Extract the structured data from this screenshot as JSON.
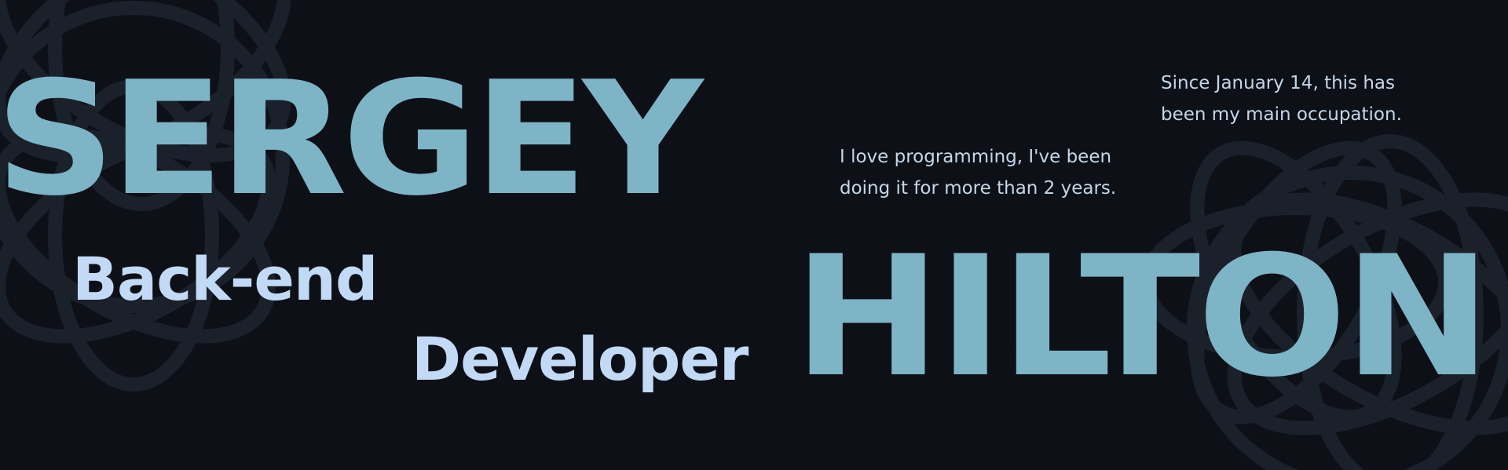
{
  "colors": {
    "background": "#0e1017",
    "name_text": "#7db4c6",
    "role_text": "#c2daf5",
    "body_text": "#c6d6e8",
    "pattern_stroke": "#1b212b"
  },
  "hero": {
    "first_name": "SERGEY",
    "last_name": "HILTON",
    "role_line_1": "Back-end",
    "role_line_2": "Developer"
  },
  "blurbs": {
    "programming": {
      "line_1": "I love programming, I've been",
      "line_2": "doing it for more than 2 years."
    },
    "occupation": {
      "line_1": "Since January 14, this has",
      "line_2": "been my main occupation."
    }
  },
  "decoration": {
    "pattern_icon": "flower-of-life-pattern"
  }
}
